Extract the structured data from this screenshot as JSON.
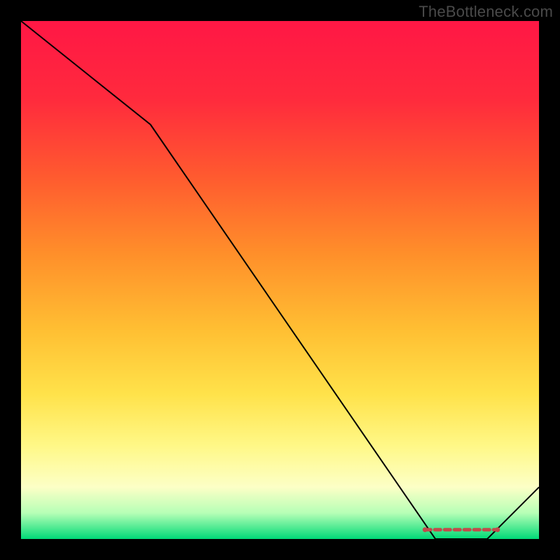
{
  "watermark": "TheBottleneck.com",
  "chart_data": {
    "type": "line",
    "title": "",
    "xlabel": "",
    "ylabel": "",
    "xlim": [
      0,
      100
    ],
    "ylim": [
      0,
      100
    ],
    "background_gradient": {
      "stops": [
        {
          "offset": 0.0,
          "color": "#ff1745"
        },
        {
          "offset": 0.15,
          "color": "#ff2a3d"
        },
        {
          "offset": 0.3,
          "color": "#ff5a2f"
        },
        {
          "offset": 0.45,
          "color": "#ff8f2a"
        },
        {
          "offset": 0.6,
          "color": "#ffc033"
        },
        {
          "offset": 0.72,
          "color": "#ffe24a"
        },
        {
          "offset": 0.82,
          "color": "#fff887"
        },
        {
          "offset": 0.9,
          "color": "#fcffc6"
        },
        {
          "offset": 0.95,
          "color": "#b6ffb6"
        },
        {
          "offset": 1.0,
          "color": "#00d977"
        }
      ]
    },
    "series": [
      {
        "name": "bottleneck-line",
        "color": "#000000",
        "x": [
          0,
          25,
          80,
          90,
          100
        ],
        "y": [
          100,
          80,
          0,
          0,
          10
        ]
      }
    ],
    "markers": {
      "name": "optimal-region",
      "color": "#c14b4b",
      "approx_y": 1.8,
      "points_x": [
        78,
        80,
        82,
        84,
        86,
        88,
        90,
        92
      ]
    }
  }
}
